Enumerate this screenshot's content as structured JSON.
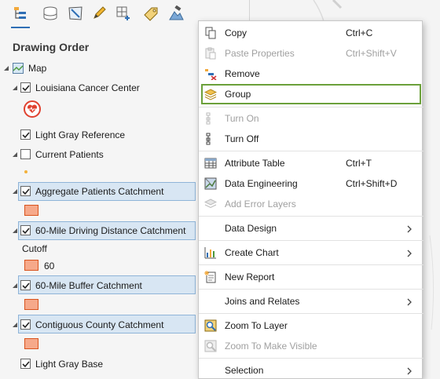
{
  "contents": {
    "heading": "Drawing Order",
    "layers": {
      "map": "Map",
      "louisiana": "Louisiana Cancer Center",
      "light_gray_reference": "Light Gray Reference",
      "current_patients": "Current Patients",
      "aggregate": "Aggregate Patients Catchment",
      "driving": "60-Mile Driving Distance Catchment",
      "cutoff_label": "Cutoff",
      "cutoff_value": "60",
      "buffer": "60-Mile Buffer Catchment",
      "contiguous": "Contiguous County Catchment",
      "light_gray_base": "Light Gray Base"
    },
    "symbol_fill": "#f6a98a",
    "symbol_outline": "#d9541e",
    "selection_color": "#d8e6f3"
  },
  "toolbar_icons": [
    "list-by-drawing-order-icon",
    "list-by-source-icon",
    "list-by-selection-icon",
    "list-by-editing-icon",
    "list-by-snapping-icon",
    "list-by-labeling-icon",
    "list-by-perspective-imagery-icon"
  ],
  "menu": {
    "highlight_color": "#6ba03a",
    "items": {
      "copy": {
        "label": "Copy",
        "shortcut": "Ctrl+C"
      },
      "paste": {
        "label": "Paste Properties",
        "shortcut": "Ctrl+Shift+V"
      },
      "remove": {
        "label": "Remove"
      },
      "group": {
        "label": "Group"
      },
      "turn_on": {
        "label": "Turn On"
      },
      "turn_off": {
        "label": "Turn Off"
      },
      "attribute_table": {
        "label": "Attribute Table",
        "shortcut": "Ctrl+T"
      },
      "data_engineering": {
        "label": "Data Engineering",
        "shortcut": "Ctrl+Shift+D"
      },
      "add_error_layers": {
        "label": "Add Error Layers"
      },
      "data_design": {
        "label": "Data Design"
      },
      "create_chart": {
        "label": "Create Chart"
      },
      "new_report": {
        "label": "New Report"
      },
      "joins": {
        "label": "Joins and Relates"
      },
      "zoom_to_layer": {
        "label": "Zoom To Layer"
      },
      "zoom_visible": {
        "label": "Zoom To Make Visible"
      },
      "selection": {
        "label": "Selection"
      }
    }
  }
}
